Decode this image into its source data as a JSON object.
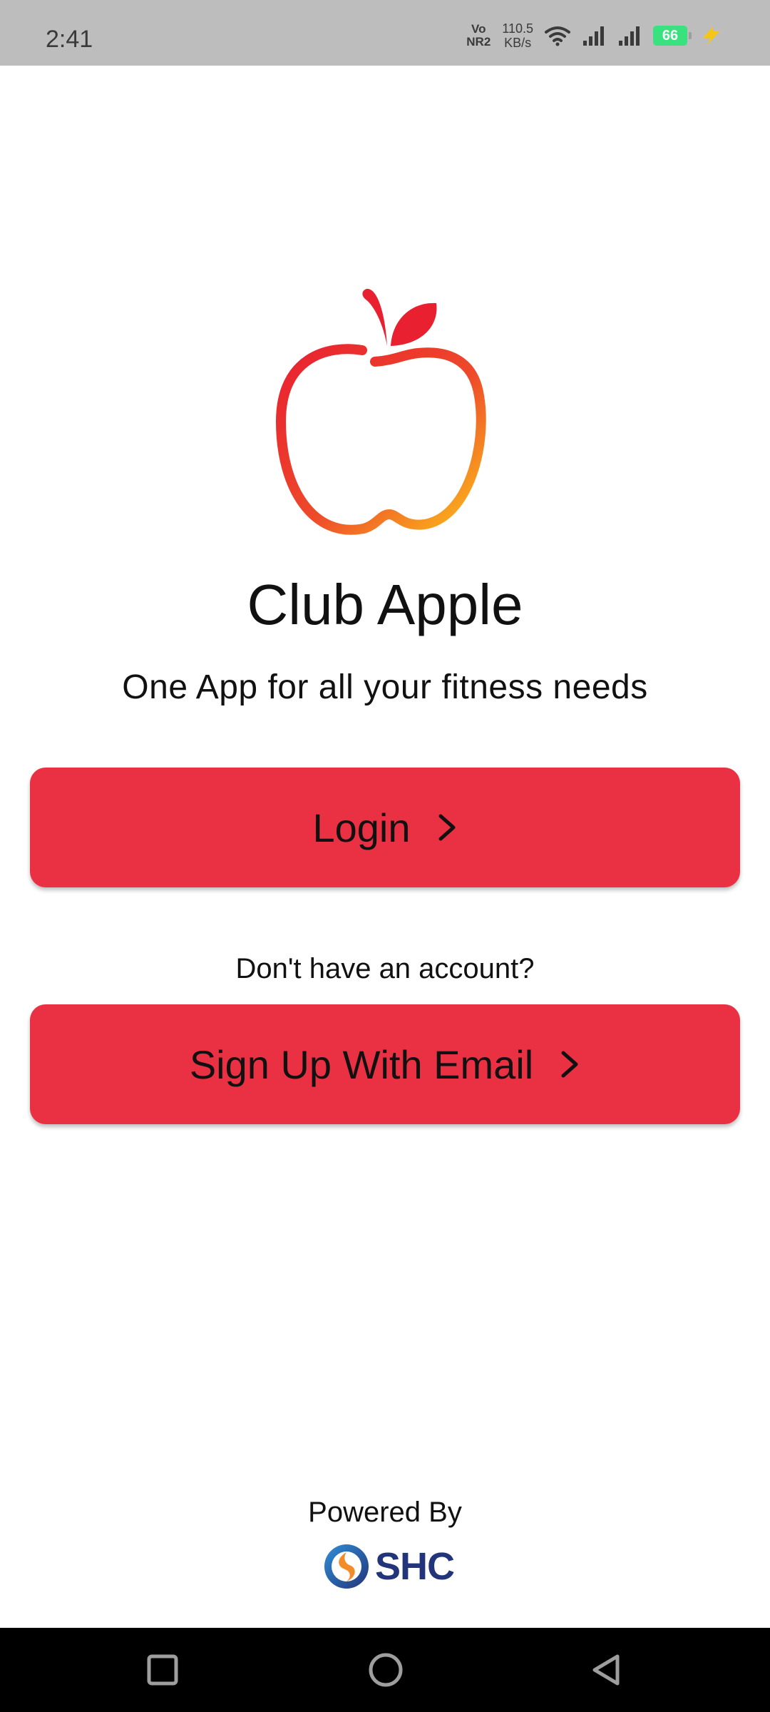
{
  "status_bar": {
    "time": "2:41",
    "volte_top": "Vo",
    "volte_bottom": "NR2",
    "speed_value": "110.5",
    "speed_unit": "KB/s",
    "battery_level": "66",
    "icons": [
      "volte-icon",
      "wifi-icon",
      "signal-icon",
      "signal-icon",
      "battery-icon",
      "charging-icon"
    ]
  },
  "app": {
    "title": "Club Apple",
    "tagline": "One App for all your fitness needs"
  },
  "buttons": {
    "login": "Login",
    "signup": "Sign Up With Email"
  },
  "prompt": {
    "no_account": "Don't have an account?"
  },
  "footer": {
    "powered_by": "Powered By",
    "brand": "SHC"
  },
  "colors": {
    "primary_button": "#ea3043",
    "status_bar": "#bdbdbd",
    "nav_bar": "#000000",
    "brand_text": "#23357a"
  },
  "nav": {
    "items": [
      "recents-icon",
      "home-icon",
      "back-icon"
    ]
  }
}
